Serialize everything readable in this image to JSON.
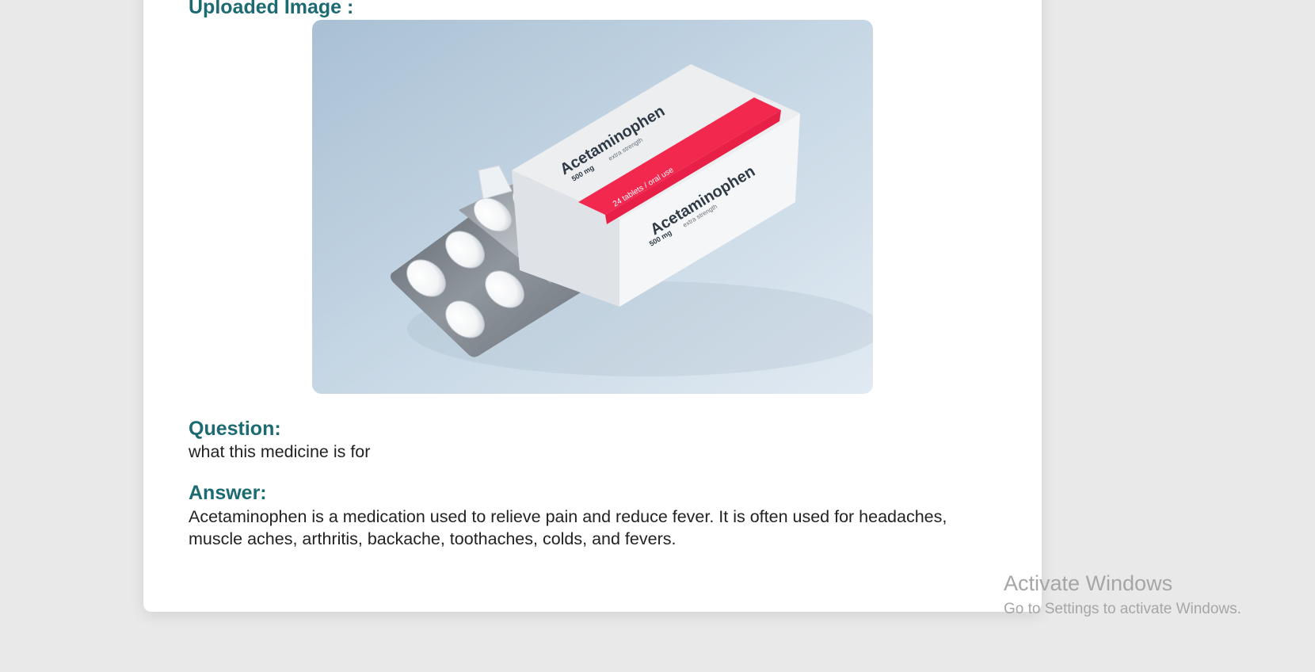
{
  "card": {
    "image_heading": "Uploaded Image :",
    "question_heading": "Question:",
    "question_text": "what this medicine is for",
    "answer_heading": "Answer:",
    "answer_text": "Acetaminophen is a medication used to relieve pain and reduce fever. It is often used for headaches, muscle aches, arthritis, backache, toothaches, colds, and fevers."
  },
  "image": {
    "box_brand_top": "Acetaminophen",
    "box_dose_top": "500 mg",
    "box_strength_top": "extra strength",
    "box_stripe_text": "24 tablets / oral use",
    "box_brand_side": "Acetaminophen",
    "box_dose_side": "500 mg",
    "box_strength_side": "extra strength",
    "stripe_color": "#f2284f"
  },
  "watermark": {
    "title": "Activate Windows",
    "subtitle": "Go to Settings to activate Windows."
  },
  "colors": {
    "heading": "#1c6a72",
    "page_background": "#e9e9e9",
    "card_background": "#ffffff"
  }
}
